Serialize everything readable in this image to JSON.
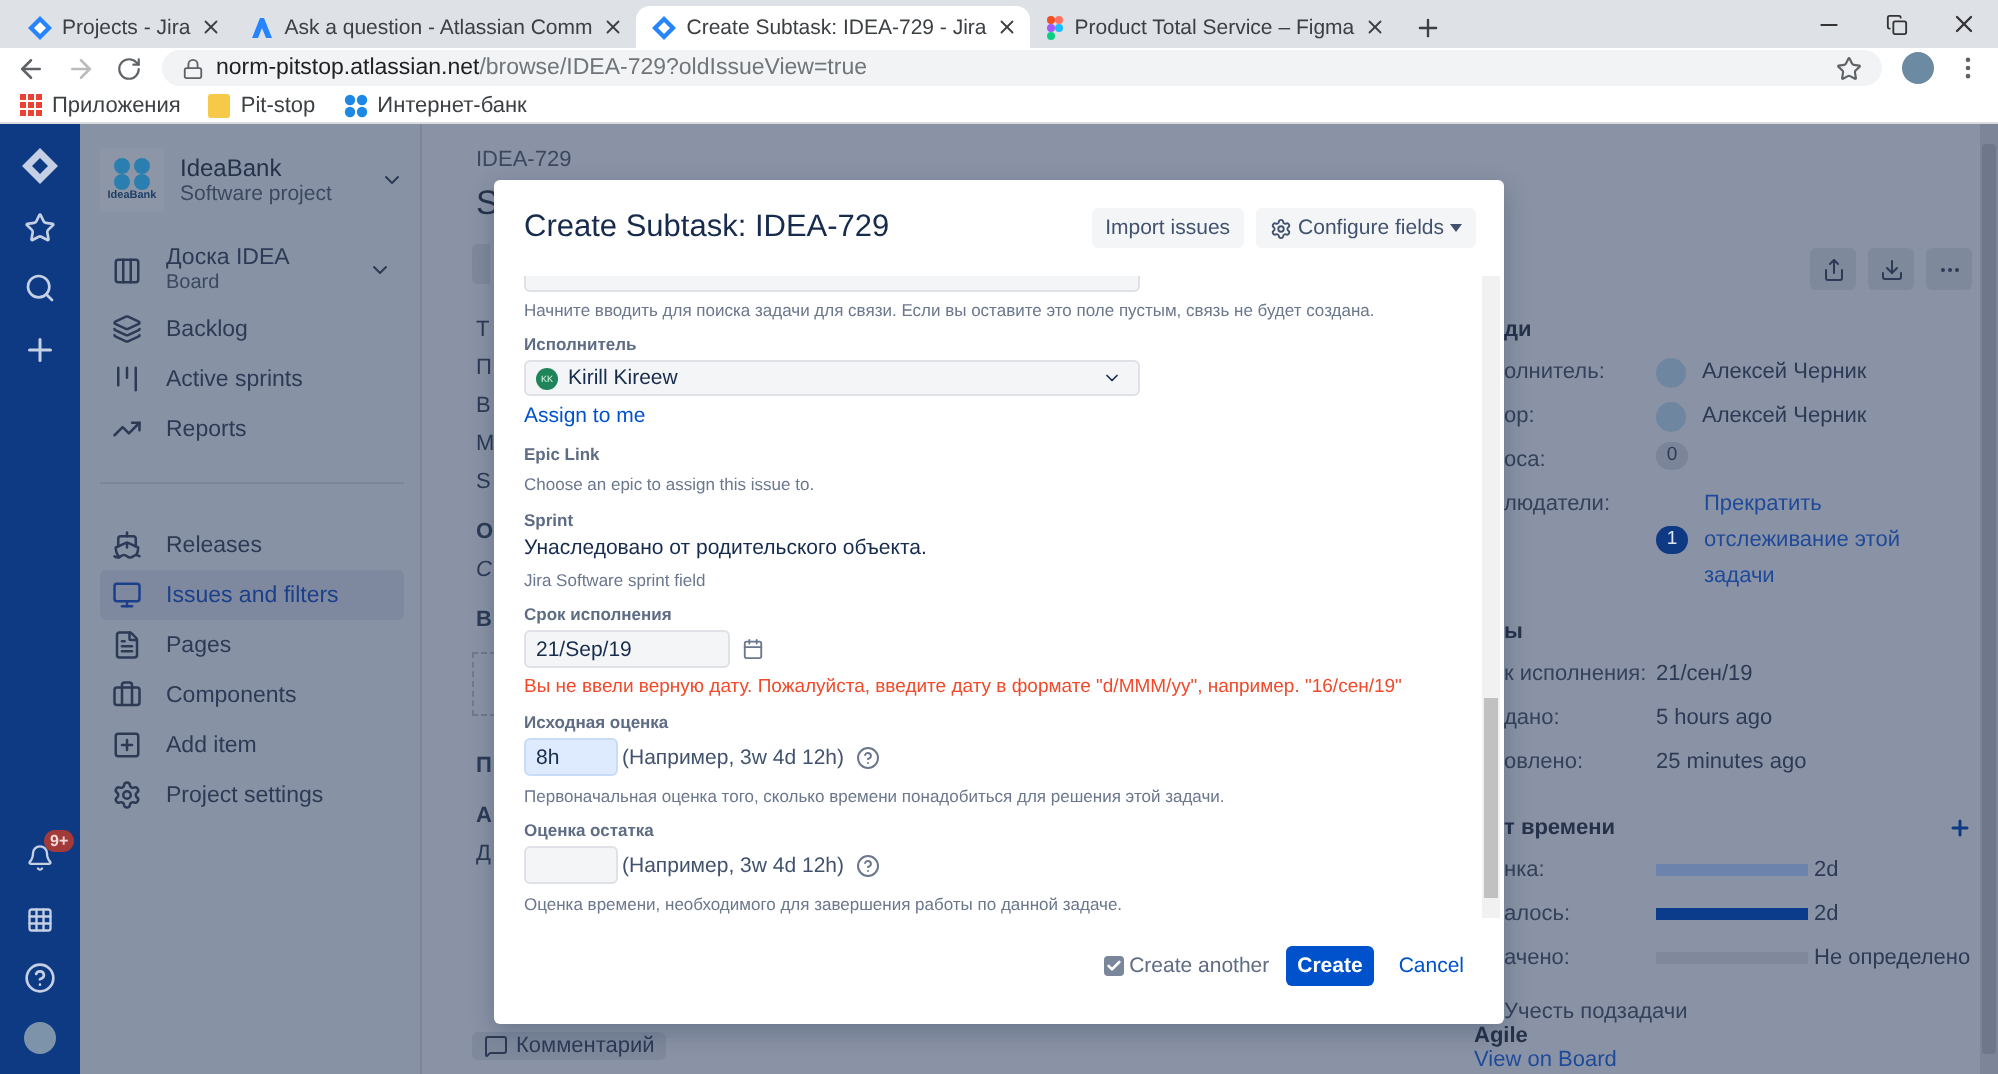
{
  "browser": {
    "tabs": [
      {
        "title": "Projects - Jira",
        "selected": false
      },
      {
        "title": "Ask a question - Atlassian Comm",
        "selected": false
      },
      {
        "title": "Create Subtask: IDEA-729 - Jira",
        "selected": true
      },
      {
        "title": "Product Total Service – Figma",
        "selected": false
      }
    ],
    "url": {
      "host": "norm-pitstop.atlassian.net",
      "path": "/browse/IDEA-729?oldIssueView=true"
    },
    "bookmarks": [
      "Приложения",
      "Pit-stop",
      "Интернет-банк"
    ]
  },
  "global_nav": {
    "notification_badge": "9+"
  },
  "project": {
    "name": "IdeaBank",
    "type": "Software project",
    "logo_text": "IdeaBank"
  },
  "sidebar": {
    "groups": [
      [
        {
          "label": "Доска IDEA",
          "sublabel": "Board",
          "expandable": true,
          "selected": false
        },
        {
          "label": "Backlog",
          "expandable": false,
          "selected": false
        },
        {
          "label": "Active sprints",
          "expandable": false,
          "selected": false
        },
        {
          "label": "Reports",
          "expandable": false,
          "selected": false
        }
      ],
      [
        {
          "label": "Releases",
          "expandable": false,
          "selected": false
        },
        {
          "label": "Issues and filters",
          "expandable": false,
          "selected": true
        },
        {
          "label": "Pages",
          "expandable": false,
          "selected": false
        },
        {
          "label": "Components",
          "expandable": false,
          "selected": false
        },
        {
          "label": "Add item",
          "expandable": false,
          "selected": false
        },
        {
          "label": "Project settings",
          "expandable": false,
          "selected": false
        }
      ]
    ]
  },
  "issue": {
    "key": "IDEA-729",
    "title": "S",
    "fragments": [
      {
        "kind": "label",
        "text": "Т"
      },
      {
        "kind": "label",
        "text": "П"
      },
      {
        "kind": "label",
        "text": "В"
      },
      {
        "kind": "label",
        "text": "М"
      },
      {
        "kind": "label",
        "text": "S"
      },
      {
        "kind": "heading",
        "text": "О"
      },
      {
        "kind": "italic",
        "text": "С"
      },
      {
        "kind": "heading",
        "text": "В"
      },
      {
        "kind": "dropzone"
      },
      {
        "kind": "heading",
        "text": "П"
      },
      {
        "kind": "heading",
        "text": "А"
      },
      {
        "kind": "label",
        "text": "Д"
      }
    ],
    "comment_button": "Комментарий"
  },
  "details": {
    "sections": [
      {
        "heading": "ди",
        "rows": [
          {
            "kind": "user",
            "label": "олнитель:",
            "value": "Алексей Черник"
          },
          {
            "kind": "user",
            "label": "ор:",
            "value": "Алексей Черник"
          },
          {
            "kind": "count",
            "label": "оса:",
            "count": "0",
            "highlighted": false
          },
          {
            "kind": "count",
            "label": "людатели:",
            "count": "1",
            "highlighted": true,
            "link": "Прекратить отслеживание этой задачи"
          }
        ]
      },
      {
        "heading": "ы",
        "rows": [
          {
            "kind": "text",
            "label": "к исполнения:",
            "value": "21/сен/19"
          },
          {
            "kind": "text",
            "label": "дано:",
            "value": "5 hours ago"
          },
          {
            "kind": "text",
            "label": "овлено:",
            "value": "25 minutes ago"
          }
        ]
      },
      {
        "heading": "т времени",
        "add": true,
        "rows": [
          {
            "kind": "bar",
            "label": "нка:",
            "level": 1,
            "color": "#6c84ab",
            "value": "2d"
          },
          {
            "kind": "bar",
            "label": "алось:",
            "level": 1,
            "color": "#0b3c8c",
            "value": "2d"
          },
          {
            "kind": "bar",
            "label": "ачено:",
            "level": 0,
            "color": "#7f899b",
            "value": "Не определено"
          }
        ]
      }
    ],
    "subtasks_option": "Учесть подзадачи",
    "agile": {
      "heading": "Agile",
      "link": "View on Board"
    }
  },
  "modal": {
    "title": "Create Subtask: IDEA-729",
    "header_buttons": [
      "Import issues",
      "Configure fields"
    ],
    "fields": [
      {
        "kind": "cut-input",
        "hint": "Начните вводить для поиска задачи для связи. Если вы оставите это поле пустым, связь не будет создана."
      },
      {
        "kind": "user-select",
        "label": "Исполнитель",
        "initials": "KK",
        "value": "Kirill Kireew",
        "link": "Assign to me"
      },
      {
        "kind": "static",
        "label": "Epic Link",
        "hint": "Choose an epic to assign this issue to."
      },
      {
        "kind": "static",
        "label": "Sprint",
        "value": "Унаследовано от родительского объекта.",
        "hint": "Jira Software sprint field"
      },
      {
        "kind": "date",
        "label": "Срок исполнения",
        "value": "21/Sep/19",
        "error": "Вы не ввели верную дату. Пожалуйста, введите дату в формате \"d/MMM/yy\", например. \"16/сен/19\""
      },
      {
        "kind": "estimate",
        "label": "Исходная оценка",
        "value": "8h",
        "focused": true,
        "suffix": "(Например, 3w 4d 12h)",
        "hint": "Первоначальная оценка того, сколько времени понадобиться для решения этой задачи."
      },
      {
        "kind": "estimate",
        "label": "Оценка остатка",
        "focused": false,
        "suffix": "(Например, 3w 4d 12h)",
        "hint": "Оценка времени, необходимого для завершения работы по данной задаче."
      }
    ],
    "create_another": {
      "label": "Create another",
      "checked": true
    },
    "submit": "Create",
    "cancel": "Cancel"
  }
}
